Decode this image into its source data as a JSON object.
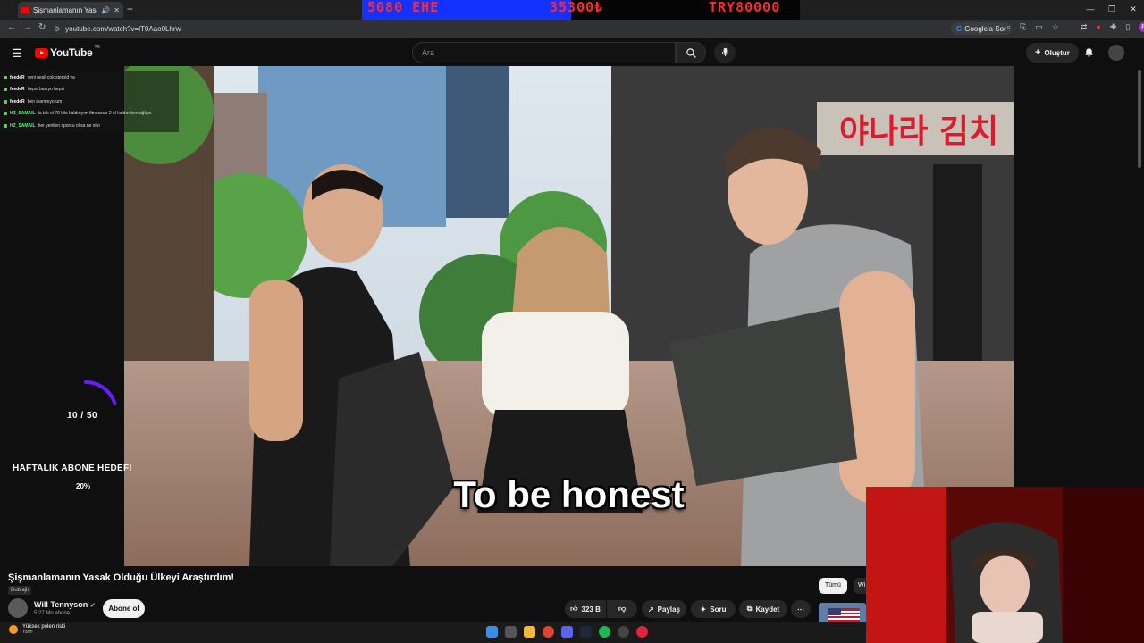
{
  "browser": {
    "tab_title": "Şişmanlamanın Yasak Olduğu...",
    "url": "youtube.com/watch?v=lT0Aao0Lhrw",
    "google_sor": "Google'a Sor",
    "profile_initial": "R"
  },
  "stream_overlay_top": {
    "left_text": "5080 EHE",
    "mid_text": "35300₺",
    "right_text": "TRY80000"
  },
  "youtube_header": {
    "logo": "YouTube",
    "region": "TR",
    "search_placeholder": "Ara",
    "create_label": "Oluştur"
  },
  "chat": [
    {
      "user": "feedeR",
      "message": "yeni nesil çok steroid ya"
    },
    {
      "user": "feedeR",
      "message": "hepsi basıyo hepsi"
    },
    {
      "user": "feedeR",
      "message": "ben inanmıyorum"
    },
    {
      "user": "HZ_SAMAIL",
      "message": "la tek el 70 kilo kaldırıyım fitnessıar 2 el kaldırırken ağlıyo"
    },
    {
      "user": "HZ_SAMAIL",
      "message": "her yenilen sporcu oltsa ne olur"
    }
  ],
  "sub_goal": {
    "count": "10 / 50",
    "title": "HAFTALIK ABONE HEDEFI",
    "percent": "20%",
    "progress": 0.2
  },
  "video": {
    "caption": "To be honest",
    "title": "Şişmanlamanın Yasak Olduğu Ülkeyi Araştırdım!",
    "dub_badge": "Dublajlı"
  },
  "channel": {
    "name": "Will Tennyson",
    "subs": "5,27 Mn abone",
    "subscribe_label": "Abone ol"
  },
  "actions": {
    "likes": "323 B",
    "share": "Paylaş",
    "ask": "Soru",
    "save": "Kaydet",
    "more": "⋯"
  },
  "chips": {
    "all": "Tümü",
    "next": "Wi"
  },
  "taskbar": {
    "weather_title": "Yüksek polen riski",
    "weather_sub": "Yarın"
  },
  "colors": {
    "youtube_red": "#ff0000",
    "overlay_blue": "#1332ff",
    "overlay_text": "#ff2a2a",
    "chat_green": "#4cff64"
  }
}
